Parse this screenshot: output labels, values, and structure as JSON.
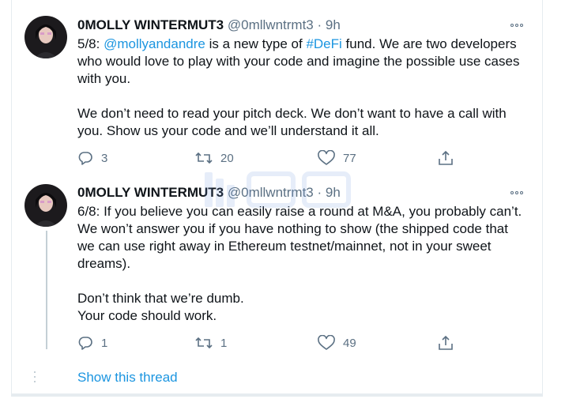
{
  "tweets": [
    {
      "name": "0MOLLY WINTERMUT3",
      "handle": "@0mllwntrmt3",
      "separator": "·",
      "time": "9h",
      "body": {
        "prefix": "5/8: ",
        "mention": "@mollyandandre",
        "middle": " is a new type of ",
        "hashtag": "#DeFi",
        "rest": " fund. We are two developers who would love to play with your code and imagine the possible use cases with you.",
        "paragraph2": "We don’t need to read your pitch deck. We don’t want to have a call with you. Show us your code and we’ll understand it all."
      },
      "actions": {
        "replies": "3",
        "retweets": "20",
        "likes": "77"
      }
    },
    {
      "name": "0MOLLY WINTERMUT3",
      "handle": "@0mllwntrmt3",
      "separator": "·",
      "time": "9h",
      "body": {
        "paragraph1": "6/8: If you believe you can easily raise a round at M&A, you probably can’t. We won’t answer you if you have nothing to show (the shipped code that we can use right away in Ethereum testnet/mainnet, not in your sweet dreams).",
        "paragraph2_line1": "Don’t think that we’re dumb.",
        "paragraph2_line2": "Your code should work."
      },
      "actions": {
        "replies": "1",
        "retweets": "1",
        "likes": "49"
      }
    }
  ],
  "show_thread": "Show this thread",
  "icons": {
    "reply": "reply-icon",
    "retweet": "retweet-icon",
    "like": "heart-icon",
    "share": "share-icon",
    "more": "more-icon"
  },
  "colors": {
    "link": "#1b95e0",
    "muted": "#5b7083",
    "text": "#0f1419",
    "border": "#e6ecf0"
  }
}
